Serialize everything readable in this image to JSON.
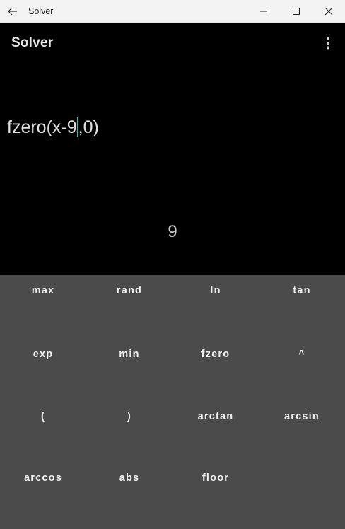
{
  "window": {
    "title": "Solver"
  },
  "app": {
    "title": "Solver"
  },
  "expression": {
    "before_cursor": "fzero(x-9",
    "after_cursor": ",0)"
  },
  "result": "9",
  "keys": [
    "max",
    "rand",
    "ln",
    "tan",
    "exp",
    "min",
    "fzero",
    "^",
    "(",
    ")",
    "arctan",
    "arcsin",
    "arccos",
    "abs",
    "floor",
    ""
  ],
  "colors": {
    "accent_cursor": "#3fb6a8",
    "keypad_bg": "#4b4b4b",
    "display_bg": "#000000"
  }
}
